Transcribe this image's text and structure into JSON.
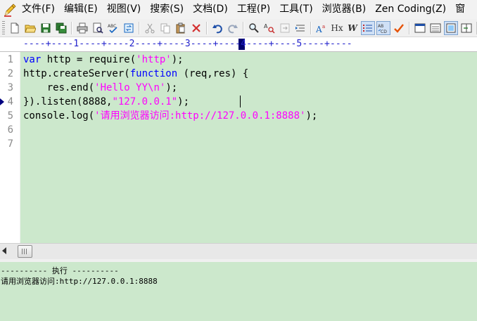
{
  "menu": {
    "items": [
      "文件(F)",
      "编辑(E)",
      "视图(V)",
      "搜索(S)",
      "文档(D)",
      "工程(P)",
      "工具(T)",
      "浏览器(B)",
      "Zen Coding(Z)",
      "窗"
    ]
  },
  "toolbar": {
    "buttons": [
      "new-file-icon",
      "open-folder-icon",
      "save-icon",
      "save-all-icon",
      "print-icon",
      "print-preview-icon",
      "spell-check-icon",
      "convert-icon",
      "cut-icon",
      "copy-icon",
      "paste-icon",
      "delete-icon",
      "undo-icon",
      "redo-icon",
      "find-icon",
      "replace-icon",
      "goto-icon",
      "indent-icon",
      "font-size-icon",
      "hex-view-icon",
      "word-wrap-icon",
      "line-numbers-icon",
      "ruler-icon",
      "column-mode-icon",
      "check-icon",
      "window-icon",
      "window-list-icon",
      "fullscreen-icon",
      "split-icon",
      "more-icon"
    ],
    "text_labels": {
      "hx": "Hx",
      "w": "W"
    }
  },
  "ruler": {
    "text": "----+----1----+----2----+----3----+----4----+----5----+----"
  },
  "editor": {
    "line_numbers": [
      "1",
      "2",
      "3",
      "4",
      "5",
      "6",
      "7"
    ],
    "lines": [
      [
        {
          "t": "var",
          "c": "kw"
        },
        {
          "t": " http = require(",
          "c": ""
        },
        {
          "t": "'http'",
          "c": "str"
        },
        {
          "t": ");",
          "c": ""
        }
      ],
      [
        {
          "t": "http.createServer(",
          "c": ""
        },
        {
          "t": "function",
          "c": "kw"
        },
        {
          "t": " (req,res) {",
          "c": ""
        }
      ],
      [
        {
          "t": "    res.end(",
          "c": ""
        },
        {
          "t": "'Hello YY\\n'",
          "c": "str"
        },
        {
          "t": ");",
          "c": ""
        }
      ],
      [
        {
          "t": "}).listen(8888,",
          "c": ""
        },
        {
          "t": "\"127.0.0.1\"",
          "c": "str"
        },
        {
          "t": ");",
          "c": ""
        }
      ],
      [
        {
          "t": "console.log(",
          "c": ""
        },
        {
          "t": "'请用浏览器访问:http://127.0.0.1:8888'",
          "c": "str"
        },
        {
          "t": ");",
          "c": ""
        }
      ],
      [],
      []
    ],
    "current_line": 4,
    "background": "#cce8cc"
  },
  "output": {
    "header": "---------- 执行 ----------",
    "lines": [
      "请用浏览器访问:http://127.0.0.1:8888"
    ]
  },
  "colors": {
    "keyword": "#0000ff",
    "string": "#ff00ff",
    "ruler": "#2222cc"
  }
}
